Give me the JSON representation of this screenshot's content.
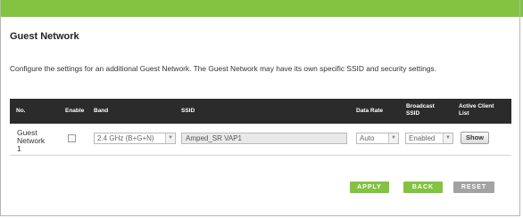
{
  "page": {
    "title": "Guest Network",
    "description": "Configure the settings for an additional Guest Network. The Guest Network may have its own specific SSID and security settings."
  },
  "table": {
    "headers": {
      "no": "No.",
      "enable": "Enable",
      "band": "Band",
      "ssid": "SSID",
      "data_rate": "Data Rate",
      "broadcast_ssid_line1": "Broadcast",
      "broadcast_ssid_line2": "SSID",
      "active_client_list_line1": "Active Client",
      "active_client_list_line2": "List"
    },
    "rows": [
      {
        "label_line1": "Guest",
        "label_line2": "Network",
        "label_line3": "1",
        "enabled": false,
        "band": "2.4 GHz (B+G+N)",
        "ssid": "Amped_SR VAP1",
        "data_rate": "Auto",
        "broadcast_ssid": "Enabled",
        "show_label": "Show"
      }
    ]
  },
  "actions": {
    "apply": "APPLY",
    "back": "BACK",
    "reset": "RESET"
  },
  "colors": {
    "accent_green": "#83c341",
    "header_dark": "#2b2b2b",
    "reset_gray": "#a3a3a3"
  },
  "icons": {
    "dropdown": "chevron-down-icon"
  }
}
